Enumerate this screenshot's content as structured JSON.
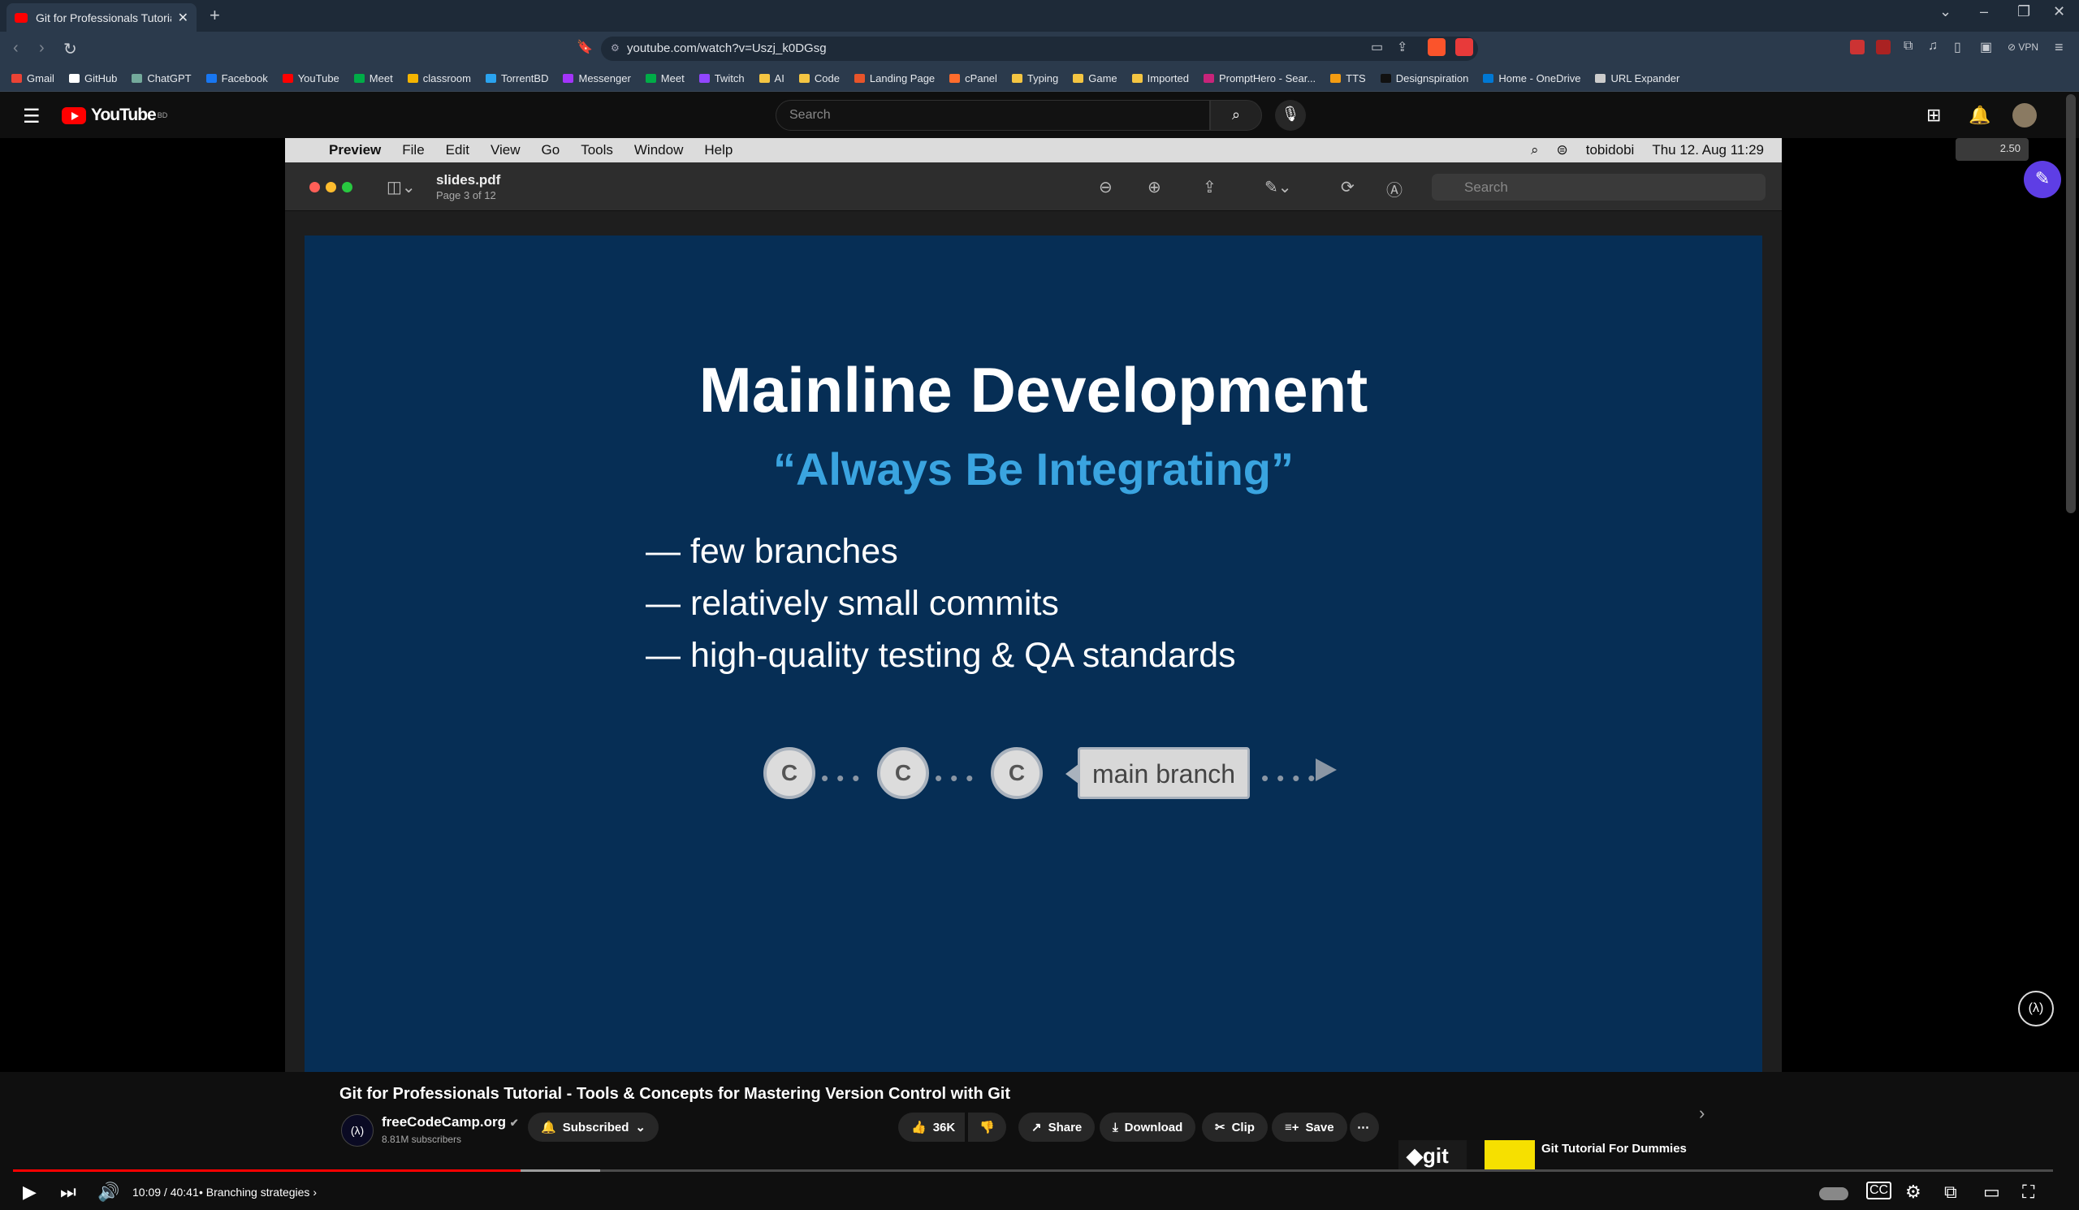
{
  "browser": {
    "tab_title": "Git for Professionals Tutorial - T",
    "url": "youtube.com/watch?v=Uszj_k0DGsg",
    "bookmarks": [
      {
        "label": "Gmail",
        "color": "#ea4335"
      },
      {
        "label": "GitHub",
        "color": "#ffffff"
      },
      {
        "label": "ChatGPT",
        "color": "#74aa9c"
      },
      {
        "label": "Facebook",
        "color": "#1877f2"
      },
      {
        "label": "YouTube",
        "color": "#ff0000"
      },
      {
        "label": "Meet",
        "color": "#00ac47"
      },
      {
        "label": "classroom",
        "color": "#f4b400"
      },
      {
        "label": "TorrentBD",
        "color": "#2aa3ef"
      },
      {
        "label": "Messenger",
        "color": "#a334fa"
      },
      {
        "label": "Meet",
        "color": "#00ac47"
      },
      {
        "label": "Twitch",
        "color": "#9146ff"
      },
      {
        "label": "AI",
        "color": "#f4c542"
      },
      {
        "label": "Code",
        "color": "#f4c542"
      },
      {
        "label": "Landing Page",
        "color": "#e8542a"
      },
      {
        "label": "cPanel",
        "color": "#ff6c2c"
      },
      {
        "label": "Typing",
        "color": "#f4c542"
      },
      {
        "label": "Game",
        "color": "#f4c542"
      },
      {
        "label": "Imported",
        "color": "#f4c542"
      },
      {
        "label": "PromptHero - Sear...",
        "color": "#c8247a"
      },
      {
        "label": "TTS",
        "color": "#f39c12"
      },
      {
        "label": "Designspiration",
        "color": "#111111"
      },
      {
        "label": "Home - OneDrive",
        "color": "#0078d4"
      },
      {
        "label": "URL Expander",
        "color": "#cccccc"
      }
    ]
  },
  "youtube": {
    "logo_text": "YouTube",
    "logo_region": "BD",
    "search_placeholder": "Search"
  },
  "mac": {
    "menus": [
      "Preview",
      "File",
      "Edit",
      "View",
      "Go",
      "Tools",
      "Window",
      "Help"
    ],
    "status_user": "tobidobi",
    "status_datetime": "Thu 12. Aug  11:29",
    "doc_name": "slides.pdf",
    "doc_page": "Page 3 of 12",
    "search_placeholder": "Search"
  },
  "slide": {
    "title": "Mainline Development",
    "subtitle": "“Always Be Integrating”",
    "bullets": [
      "— few branches",
      "— relatively small commits",
      "— high-quality testing & QA standards"
    ],
    "commit_label": "C",
    "branch_label": "main branch"
  },
  "player": {
    "time": "10:09 / 40:41",
    "chapter": "Branching strategies",
    "progress_fraction": 0.249,
    "buffered_fraction": 0.288,
    "speed_badge": "2.50"
  },
  "video": {
    "title": "Git for Professionals Tutorial - Tools & Concepts for Mastering Version Control with Git",
    "channel": "freeCodeCamp.org",
    "subscribers": "8.81M subscribers",
    "subscribed_label": "Subscribed",
    "likes": "36K",
    "share_label": "Share",
    "download_label": "Download",
    "clip_label": "Clip",
    "save_label": "Save",
    "related_title": "Git Tutorial For Dummies"
  },
  "colors": {
    "accent": "#ff0000",
    "slide_bg": "#062e55",
    "slide_subtitle": "#3aa4e0"
  }
}
